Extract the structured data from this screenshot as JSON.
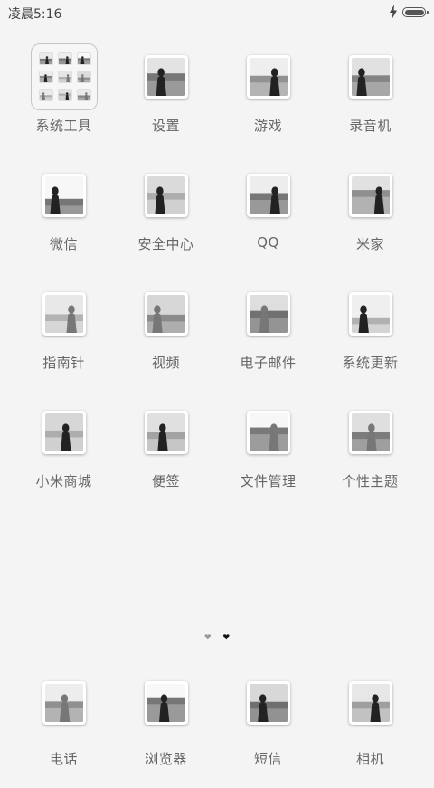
{
  "status_bar": {
    "time": "凌晨5:16",
    "charging_icon": "bolt-icon",
    "battery_icon": "battery-full-icon"
  },
  "home_grid": [
    [
      {
        "label": "系统工具",
        "kind": "folder"
      },
      {
        "label": "设置"
      },
      {
        "label": "游戏"
      },
      {
        "label": "录音机"
      }
    ],
    [
      {
        "label": "微信"
      },
      {
        "label": "安全中心"
      },
      {
        "label": "QQ"
      },
      {
        "label": "米家"
      }
    ],
    [
      {
        "label": "指南针"
      },
      {
        "label": "视频"
      },
      {
        "label": "电子邮件"
      },
      {
        "label": "系统更新"
      }
    ],
    [
      {
        "label": "小米商城"
      },
      {
        "label": "便签"
      },
      {
        "label": "文件管理"
      },
      {
        "label": "个性主题"
      }
    ]
  ],
  "page_indicator": {
    "pages": 2,
    "current": 2,
    "glyph": "❤"
  },
  "dock": [
    {
      "label": "电话"
    },
    {
      "label": "浏览器"
    },
    {
      "label": "短信"
    },
    {
      "label": "相机"
    }
  ],
  "theme": {
    "background": "#f4f4f4",
    "label_color": "#666666"
  }
}
